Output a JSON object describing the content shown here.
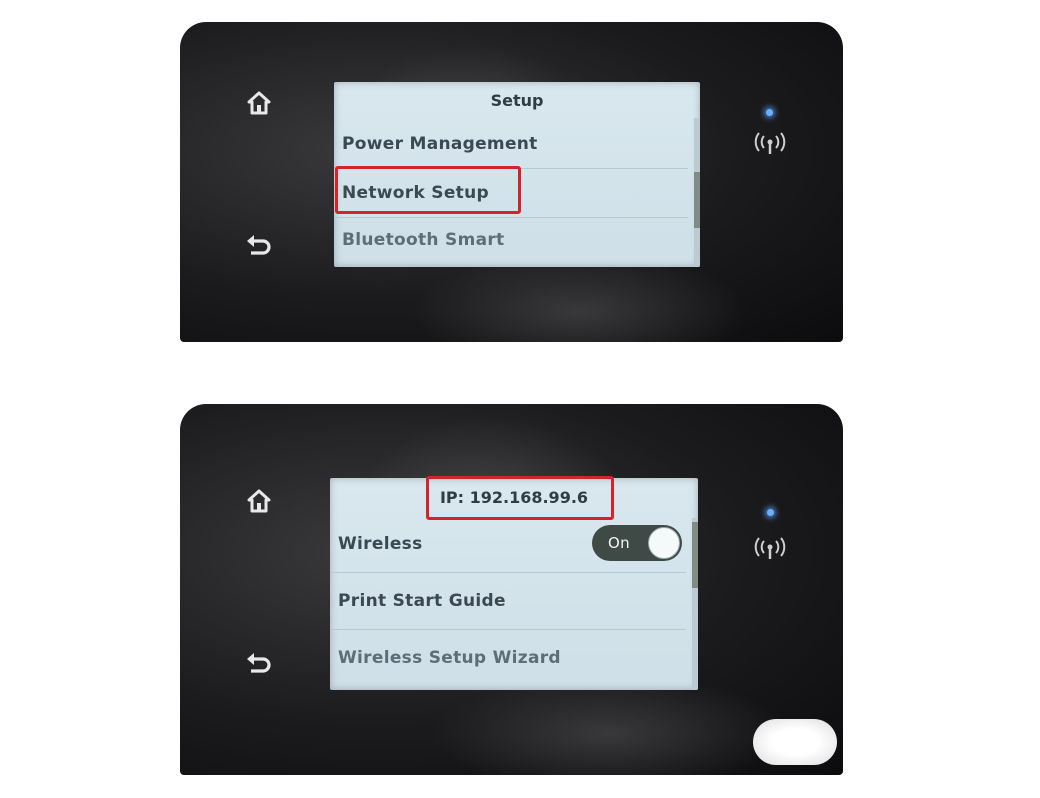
{
  "colors": {
    "panel": "#1b1b1d",
    "lcd_background": "#d9e8ef",
    "lcd_text": "#3a4953",
    "highlight": "#d6222a",
    "led": "#6ab0ff",
    "toggle": "#3f4a47"
  },
  "icons": {
    "home": "home-icon",
    "back": "back-arrow-icon",
    "wireless": "wireless-antenna-icon"
  },
  "screens": [
    {
      "title": "Setup",
      "items": [
        "Power Management",
        "Network Setup",
        "Bluetooth Smart"
      ],
      "highlighted_item": "Network Setup"
    },
    {
      "title": "IP: 192.168.99.6",
      "title_highlighted": true,
      "items": [
        {
          "label": "Wireless",
          "toggle": "On"
        },
        {
          "label": "Print Start Guide"
        },
        {
          "label": "Wireless Setup Wizard"
        }
      ]
    }
  ]
}
